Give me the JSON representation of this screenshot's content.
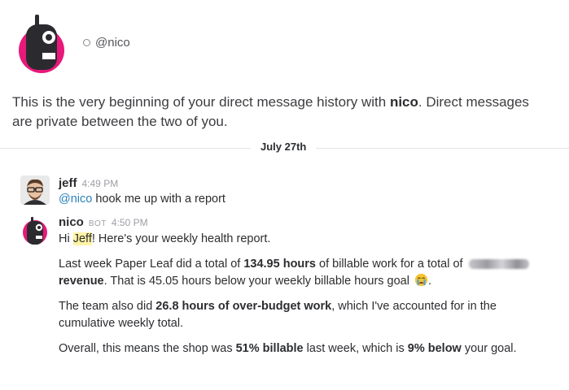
{
  "header": {
    "handle": "@nico"
  },
  "intro": {
    "lead": "This is the very beginning of your direct message history with ",
    "name": "nico",
    "tail": ". Direct messages are private between the two of you."
  },
  "divider": {
    "date": "July 27th"
  },
  "messages": [
    {
      "sender": "jeff",
      "time": "4:49 PM",
      "mention": "@nico",
      "text": " hook me up with a report"
    },
    {
      "sender": "nico",
      "badge": "BOT",
      "time": "4:50 PM",
      "greeting": {
        "hi": "Hi ",
        "name": "Jeff",
        "rest": "! Here's your weekly health report."
      },
      "p1": {
        "a": "Last week Paper Leaf did a total of ",
        "hours": "134.95 hours",
        "b": " of billable work for a total of ",
        "c": "revenue",
        "d": ". That is 45.05 hours below your weekly billable hours goal ",
        "e": ".",
        "emoji_icon": "crying-face-emoji"
      },
      "p2": {
        "a": "The team also did ",
        "bold": "26.8 hours of over-budget work",
        "b": ", which I've accounted for in the cumulative weekly total."
      },
      "p3": {
        "a": "Overall, this means the shop was ",
        "billable": "51% billable",
        "b": " last week, which is ",
        "below": "9% below",
        "c": " your goal."
      }
    }
  ],
  "colors": {
    "bot_pink": "#e8197a",
    "bot_body": "#2b2b2f",
    "mention_blue": "#2a80b9",
    "highlight": "#fff3a6"
  }
}
